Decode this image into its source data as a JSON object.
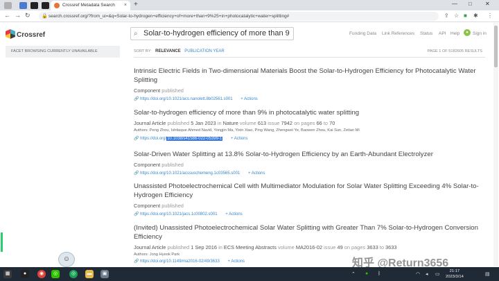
{
  "browser": {
    "active_tab_title": "Crossref Metadata Search",
    "tab_close": "×",
    "new_tab": "+",
    "url": "search.crossref.org/?from_ui=&q=Solar-to-hydrogen+efficiency+of+more+than+9%25+in+photocatalytic+water+splitting#",
    "minimize": "—",
    "maximize": "□",
    "close": "✕"
  },
  "site": {
    "logo_text": "Crossref",
    "search_value": "Solar-to-hydrogen efficiency of more than 9",
    "nav": [
      "Funding Data",
      "Link References",
      "Status",
      "API",
      "Help",
      "Sign in"
    ]
  },
  "sidebar": {
    "notice": "FACET BROWSING CURRENTLY UNAVAILABLE"
  },
  "sortbar": {
    "label": "SORT BY:",
    "relevance": "RELEVANCE",
    "pub_year": "PUBLICATION YEAR",
    "page_info": "PAGE 1 OF 5182605 RESULTS"
  },
  "results": [
    {
      "title": "Intrinsic Electric Fields in Two-dimensional Materials Boost the Solar-to-Hydrogen Efficiency for Photocatalytic Water Splitting",
      "type": "Component",
      "status": "published",
      "doi": "https://doi.org/10.1021/acs.nanolett.8b02561.s001",
      "actions": "+ Actions"
    },
    {
      "title": "Solar-to-hydrogen efficiency of more than 9% in photocatalytic water splitting",
      "type": "Journal Article",
      "status": "published",
      "date": "5 Jan 2023",
      "in_word": "in",
      "journal": "Nature",
      "volume_label": "volume",
      "volume": "613",
      "issue_label": "issue",
      "issue": "7942",
      "pages_label": "on pages",
      "page_start": "66",
      "to_word": "to",
      "page_end": "70",
      "authors": "Authors: Peng Zhou, Ishtiaque Ahmed Navid, Yongjin Ma, Yixin Xiao, Ping Wang, Zhengwei Ye, Baowen Zhou, Kai Sun, Zetian Mi",
      "doi_prefix": "https://doi.org/",
      "doi_highlight": "10.1038/s41586-022-05399-1",
      "actions": "+ Actions"
    },
    {
      "title": "Solar-Driven Water Splitting at 13.8% Solar-to-Hydrogen Efficiency by an Earth-Abundant Electrolyzer",
      "type": "Component",
      "status": "published",
      "doi": "https://doi.org/10.1021/acssuschemeng.1c03565.s001",
      "actions": "+ Actions"
    },
    {
      "title": "Unassisted Photoelectrochemical Cell with Multimediator Modulation for Solar Water Splitting Exceeding 4% Solar-to-Hydrogen Efficiency",
      "type": "Component",
      "status": "published",
      "doi": "https://doi.org/10.1021/jacs.1c00802.s001",
      "actions": "+ Actions"
    },
    {
      "title": "(Invited) Unassisted Photoelectrochemical Solar Water Splitting with Greater Than 7% Solar-to-Hydrogen Conversion Efficiency",
      "type": "Journal Article",
      "status": "published",
      "date": "1 Sep 2016",
      "in_word": "in",
      "journal": "ECS Meeting Abstracts",
      "volume_label": "volume",
      "volume": "MA2016-02",
      "issue_label": "issue",
      "issue": "49",
      "pages_label": "on pages",
      "page_start": "3633",
      "to_word": "to",
      "page_end": "3633",
      "authors": "Authors: Jong Hyeok Park",
      "doi": "https://doi.org/10.1149/ma2016-02/49/3633",
      "actions": "+ Actions"
    }
  ],
  "watermark": "知乎 @Return3656",
  "taskbar": {
    "time": "21:17",
    "date": "2023/3/14"
  }
}
